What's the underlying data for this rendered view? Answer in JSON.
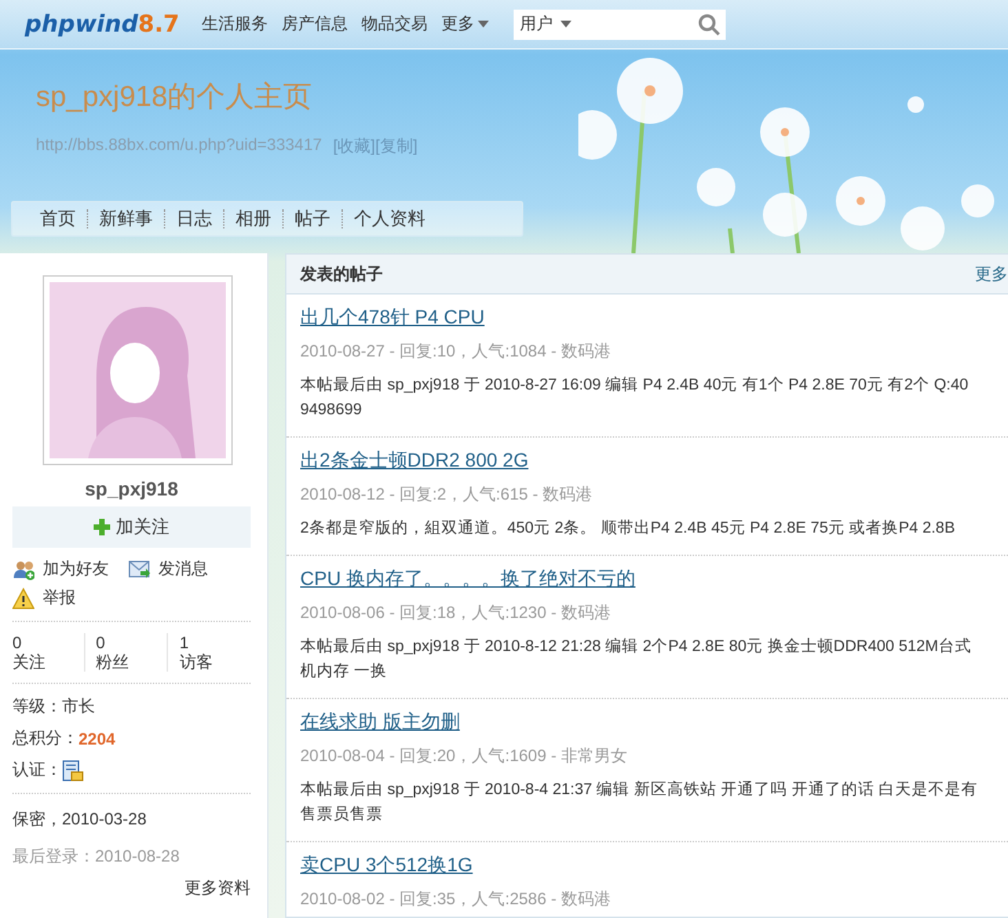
{
  "topbar": {
    "logo": {
      "name": "phpwind",
      "version": "8.7"
    },
    "menu": [
      {
        "label": "生活服务",
        "dropdown": false
      },
      {
        "label": "房产信息",
        "dropdown": false
      },
      {
        "label": "物品交易",
        "dropdown": false
      },
      {
        "label": "更多",
        "dropdown": true
      }
    ],
    "search": {
      "scope": "用户"
    }
  },
  "banner": {
    "title": "sp_pxj918的个人主页",
    "url": "http://bbs.88bx.com/u.php?uid=333417",
    "links": [
      "[收藏]",
      "[复制]"
    ],
    "tabs": [
      {
        "label": "首页",
        "selected": false
      },
      {
        "label": "新鲜事",
        "selected": false
      },
      {
        "label": "日志",
        "selected": false
      },
      {
        "label": "相册",
        "selected": false
      },
      {
        "label": "帖子",
        "selected": false
      },
      {
        "label": "个人资料",
        "selected": false
      }
    ]
  },
  "profile": {
    "username": "sp_pxj918",
    "follow_button": "加关注",
    "actions": [
      {
        "kind": "friend",
        "label": "加为好友"
      },
      {
        "kind": "message",
        "label": "发消息"
      },
      {
        "kind": "report",
        "label": "举报"
      }
    ],
    "stats": [
      {
        "value": "0",
        "label": "关注"
      },
      {
        "value": "0",
        "label": "粉丝"
      },
      {
        "value": "1",
        "label": "访客"
      }
    ],
    "level_label": "等级：",
    "level": "市长",
    "points_label": "总积分：",
    "points": "2204",
    "verify_label": "认证：",
    "birthday": "保密，2010-03-28",
    "last_login": "最后登录：2010-08-28",
    "more": "更多资料"
  },
  "posts": {
    "title": "发表的帖子",
    "more": "更多",
    "items": [
      {
        "title": "出几个478针 P4 CPU",
        "meta": "2010-08-27 - 回复:10，人气:1084 - 数码港",
        "excerpt": [
          "本帖最后由 sp_pxj918 于 2010-8-27 16:09 编辑 P4 2.4B 40元 有1个 P4 2.8E 70元 有2个 Q:40",
          "9498699"
        ]
      },
      {
        "title": "出2条金士顿DDR2 800 2G",
        "meta": "2010-08-12 - 回复:2，人气:615 - 数码港",
        "excerpt": [
          "2条都是窄版的，組双通道。450元 2条。 顺带出P4 2.4B 45元 P4 2.8E 75元 或者换P4 2.8B"
        ]
      },
      {
        "title": "CPU 换内存了。。。。换了绝对不亏的",
        "meta": "2010-08-06 - 回复:18，人气:1230 - 数码港",
        "excerpt": [
          "本帖最后由 sp_pxj918 于 2010-8-12 21:28 编辑 2个P4 2.8E 80元 换金士顿DDR400 512M台式",
          "机内存 一换"
        ]
      },
      {
        "title": "在线求助 版主勿删",
        "meta": "2010-08-04 - 回复:20，人气:1609 - 非常男女",
        "excerpt": [
          "本帖最后由 sp_pxj918 于 2010-8-4 21:37 编辑 新区高铁站 开通了吗 开通了的话 白天是不是有",
          "售票员售票"
        ]
      },
      {
        "title": "卖CPU 3个512换1G",
        "meta": "2010-08-02 - 回复:35，人气:2586 - 数码港"
      }
    ]
  }
}
